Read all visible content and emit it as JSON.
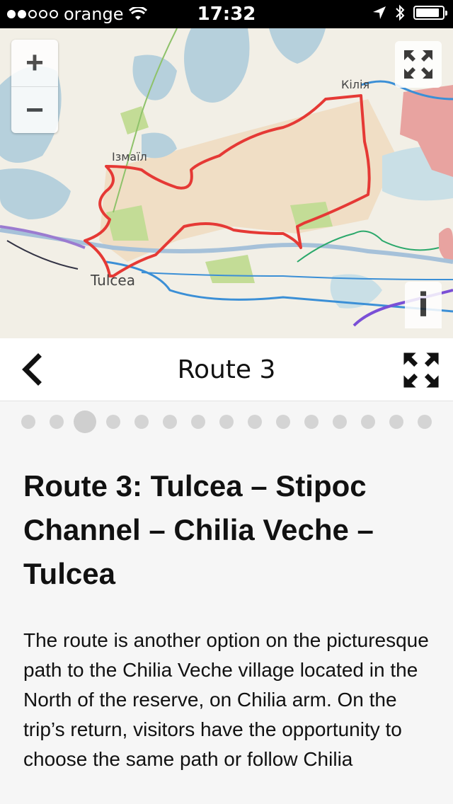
{
  "statusbar": {
    "carrier": "orange",
    "time": "17:32"
  },
  "map": {
    "labels": {
      "izmail": "Ізмаїл",
      "kiliia": "Кілія",
      "tulcea": "Tulcea"
    },
    "zoom_in": "+",
    "zoom_out": "−",
    "info": "i",
    "route_color": "#e53935"
  },
  "header": {
    "title": "Route 3"
  },
  "pager": {
    "total": 15,
    "active_index": 2
  },
  "article": {
    "heading": "Route 3: Tulcea – Stipoc Channel – Chilia Veche – Tulcea",
    "body": "The route is another option on the picturesque path to the Chilia Veche village located in the North of the reserve, on Chilia arm. On the trip’s return, visitors have the opportunity to choose the same path or follow Chilia"
  }
}
